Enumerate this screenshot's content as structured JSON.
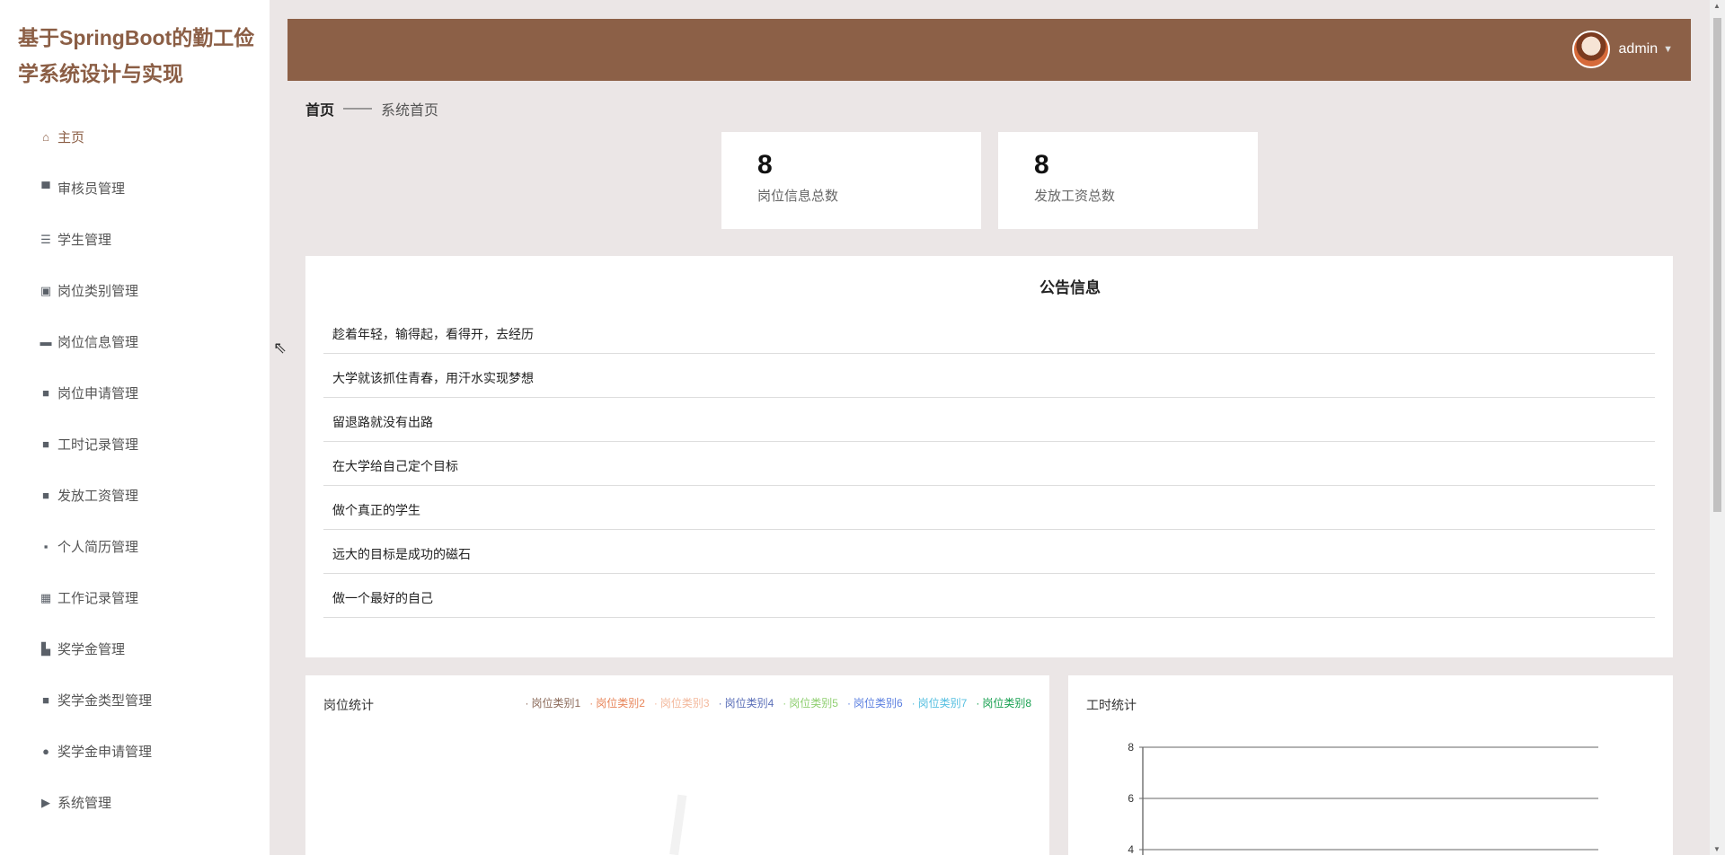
{
  "app": {
    "title": "基于SpringBoot的勤工俭学系统设计与实现"
  },
  "sidebar": {
    "items": [
      {
        "label": "主页",
        "icon": "home-icon"
      },
      {
        "label": "审核员管理",
        "icon": "user-icon"
      },
      {
        "label": "学生管理",
        "icon": "list-icon"
      },
      {
        "label": "岗位类别管理",
        "icon": "clipboard-icon"
      },
      {
        "label": "岗位信息管理",
        "icon": "monitor-icon"
      },
      {
        "label": "岗位申请管理",
        "icon": "grid-icon"
      },
      {
        "label": "工时记录管理",
        "icon": "grid-icon"
      },
      {
        "label": "发放工资管理",
        "icon": "grid-icon"
      },
      {
        "label": "个人简历管理",
        "icon": "message-icon"
      },
      {
        "label": "工作记录管理",
        "icon": "apps-icon"
      },
      {
        "label": "奖学金管理",
        "icon": "thumb-icon"
      },
      {
        "label": "奖学金类型管理",
        "icon": "grid-icon"
      },
      {
        "label": "奖学金申请管理",
        "icon": "bulb-icon"
      },
      {
        "label": "系统管理",
        "icon": "video-icon"
      }
    ]
  },
  "header": {
    "username": "admin"
  },
  "breadcrumb": {
    "home": "首页",
    "sep": "——",
    "current": "系统首页"
  },
  "stats": [
    {
      "value": "8",
      "label": "岗位信息总数"
    },
    {
      "value": "8",
      "label": "发放工资总数"
    }
  ],
  "notice": {
    "title": "公告信息",
    "items": [
      "趁着年轻，输得起，看得开，去经历",
      "大学就该抓住青春，用汗水实现梦想",
      "留退路就没有出路",
      "在大学给自己定个目标",
      "做个真正的学生",
      "远大的目标是成功的磁石",
      "做一个最好的自己"
    ]
  },
  "colors": {
    "brand": "#8c6047",
    "legend": [
      "#8b6a5a",
      "#e8855a",
      "#f3b89c",
      "#5b6fb8",
      "#8fcf70",
      "#5b7fe0",
      "#55bfe0",
      "#17a050"
    ]
  },
  "chart_data": [
    {
      "type": "pie",
      "title": "岗位统计",
      "legend": [
        "岗位类别1",
        "岗位类别2",
        "岗位类别3",
        "岗位类别4",
        "岗位类别5",
        "岗位类别6",
        "岗位类别7",
        "岗位类别8"
      ],
      "legend_position": "top-right"
    },
    {
      "type": "bar",
      "title": "工时统计",
      "yticks": [
        8,
        6,
        4
      ],
      "ylim": [
        0,
        8
      ],
      "grid": true
    }
  ]
}
